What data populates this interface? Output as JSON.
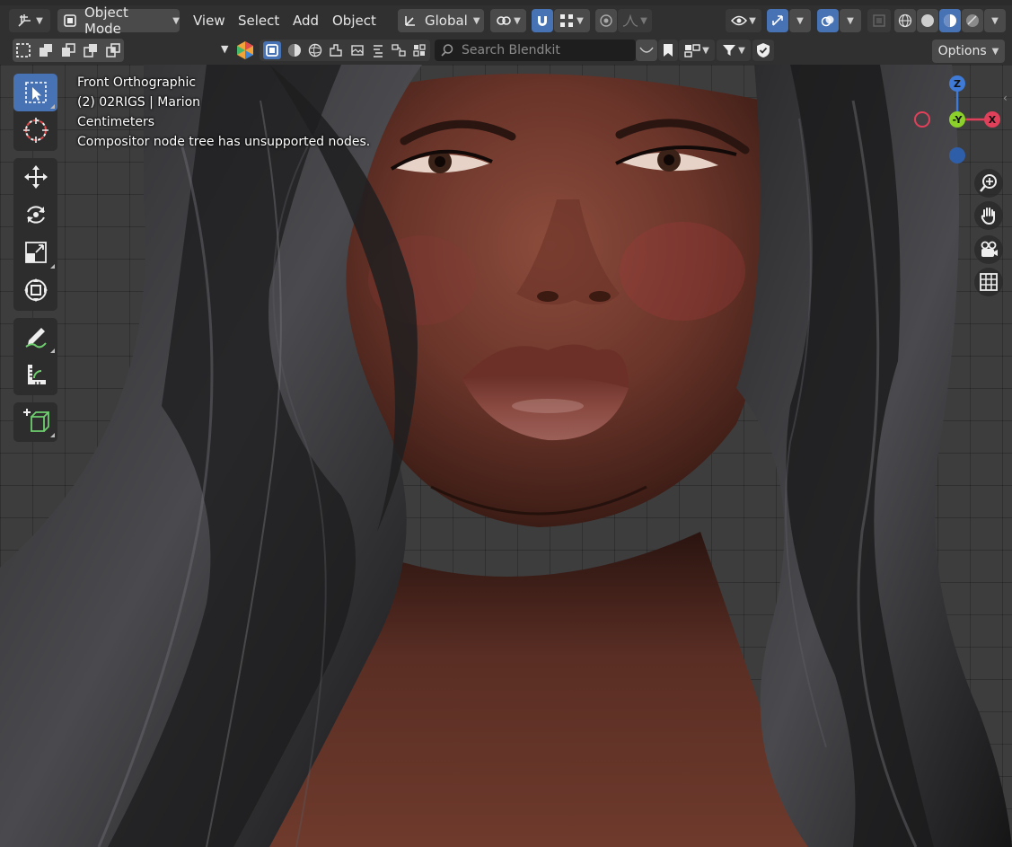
{
  "header": {
    "mode": "Object Mode",
    "menus": [
      "View",
      "Select",
      "Add",
      "Object"
    ],
    "orientation": "Global"
  },
  "subheader": {
    "search_placeholder": "Search Blendkit",
    "options_label": "Options"
  },
  "overlay": {
    "view_name": "Front Orthographic",
    "object_info": "(2) 02RIGS | Marion",
    "units": "Centimeters",
    "warning": "Compositor node tree has unsupported nodes."
  },
  "gizmo": {
    "z": "Z",
    "y": "-Y",
    "x": "X"
  },
  "colors": {
    "accent": "#4772b3",
    "header_bg": "#303030",
    "axis_x": "#e0405a",
    "axis_y": "#8bd12a",
    "axis_z": "#3f7ad6"
  },
  "tools": [
    "select-box",
    "cursor",
    "move",
    "rotate",
    "scale",
    "transform",
    "annotate",
    "measure",
    "add-cube"
  ],
  "nav_buttons": [
    "zoom",
    "pan",
    "camera",
    "ortho-toggle"
  ]
}
